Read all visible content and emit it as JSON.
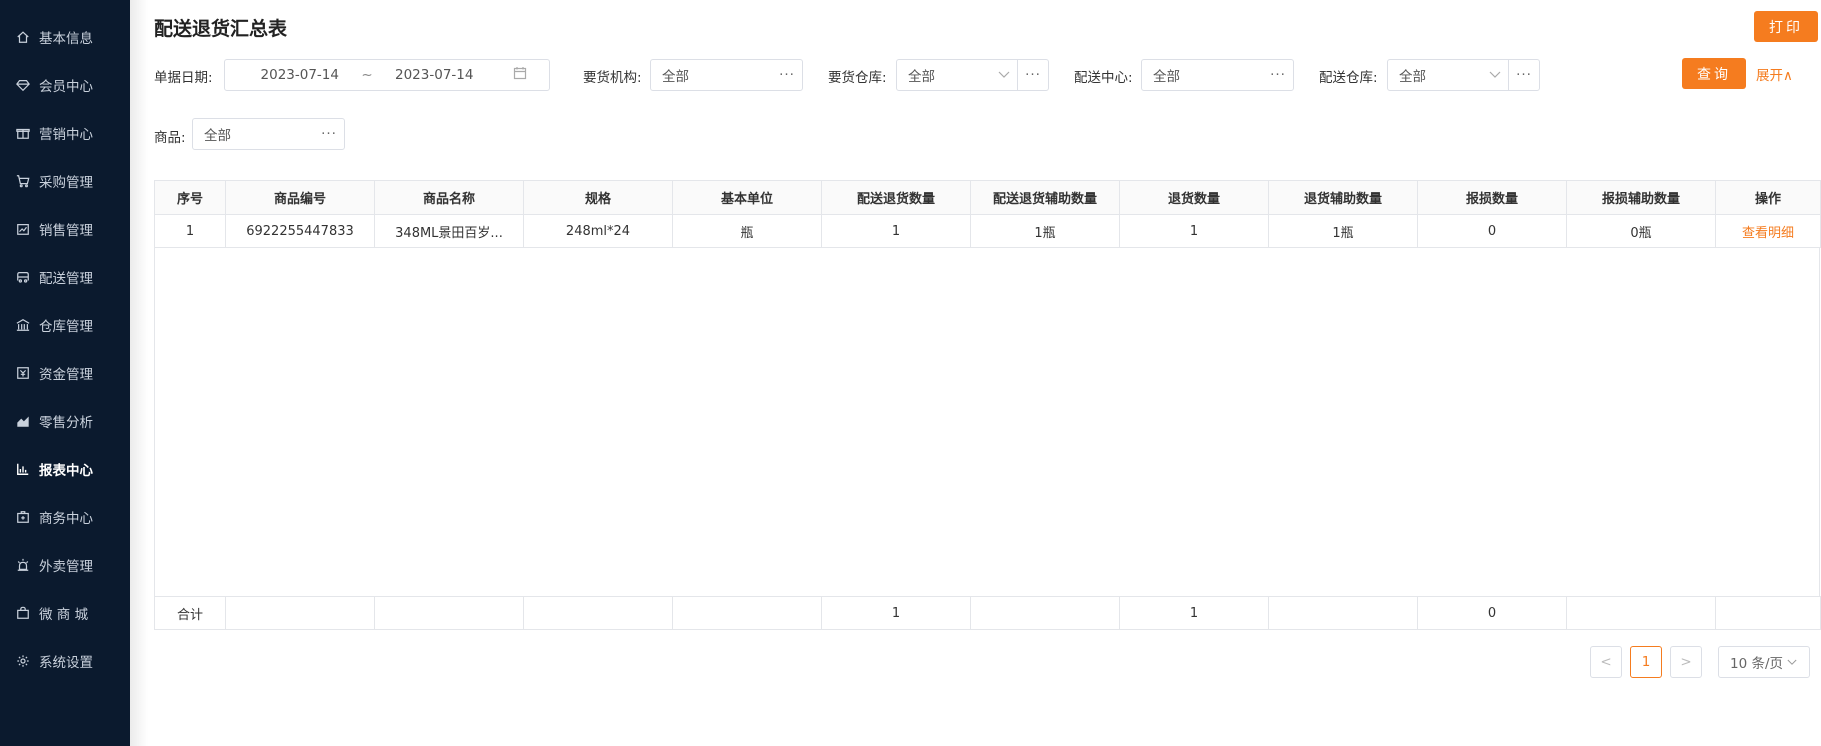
{
  "sidebar": {
    "items": [
      {
        "label": "基本信息",
        "icon": "home-icon"
      },
      {
        "label": "会员中心",
        "icon": "diamond-icon"
      },
      {
        "label": "营销中心",
        "icon": "gift-icon"
      },
      {
        "label": "采购管理",
        "icon": "cart-icon"
      },
      {
        "label": "销售管理",
        "icon": "sales-icon"
      },
      {
        "label": "配送管理",
        "icon": "truck-icon"
      },
      {
        "label": "仓库管理",
        "icon": "warehouse-icon"
      },
      {
        "label": "资金管理",
        "icon": "money-icon"
      },
      {
        "label": "零售分析",
        "icon": "area-chart-icon"
      },
      {
        "label": "报表中心",
        "icon": "bar-chart-icon"
      },
      {
        "label": "商务中心",
        "icon": "business-icon"
      },
      {
        "label": "外卖管理",
        "icon": "alarm-icon"
      },
      {
        "label": "微 商 城",
        "icon": "shop-bag-icon"
      },
      {
        "label": "系统设置",
        "icon": "gear-icon"
      }
    ],
    "active_index": 9
  },
  "page": {
    "title": "配送退货汇总表",
    "print_label": "打印"
  },
  "filters": {
    "date_label": "单据日期:",
    "date_start": "2023-07-14",
    "date_sep": "~",
    "date_end": "2023-07-14",
    "org_label": "要货机构:",
    "org_value": "全部",
    "req_wh_label": "要货仓库:",
    "req_wh_value": "全部",
    "center_label": "配送中心:",
    "center_value": "全部",
    "dist_wh_label": "配送仓库:",
    "dist_wh_value": "全部",
    "goods_label": "商品:",
    "goods_value": "全部",
    "query_label": "查询",
    "expand_label": "展开∧"
  },
  "table": {
    "headers": [
      "序号",
      "商品编号",
      "商品名称",
      "规格",
      "基本单位",
      "配送退货数量",
      "配送退货辅助数量",
      "退货数量",
      "退货辅助数量",
      "报损数量",
      "报损辅助数量",
      "操作"
    ],
    "rows": [
      [
        "1",
        "6922255447833",
        "348ML景田百岁...",
        "248ml*24",
        "瓶",
        "1",
        "1瓶",
        "1",
        "1瓶",
        "0",
        "0瓶",
        "查看明细"
      ]
    ],
    "totals": [
      "合计",
      "",
      "",
      "",
      "",
      "1",
      "",
      "1",
      "",
      "0",
      "",
      ""
    ]
  },
  "pagination": {
    "prev": "<",
    "current": "1",
    "next": ">",
    "page_size": "10 条/页"
  },
  "colors": {
    "accent": "#f57c1f",
    "sidebar_bg": "#0b1a2e"
  }
}
